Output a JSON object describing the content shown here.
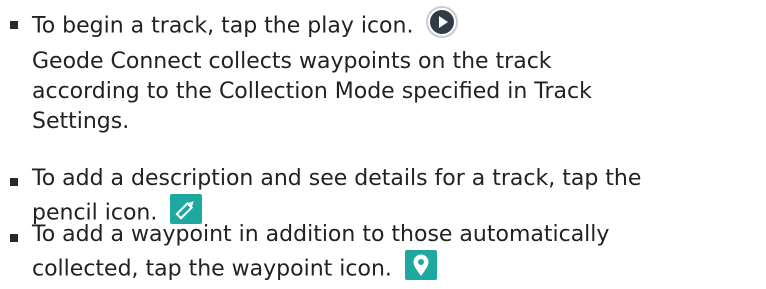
{
  "colors": {
    "text": "#222222",
    "play_icon_bg": "#2f3b47",
    "accent_teal": "#1fa8a0"
  },
  "items": [
    {
      "icon": "play-icon",
      "lines": [
        "To begin a track, tap the play icon.",
        "Geode Connect collects waypoints on the track",
        "according to the Collection Mode specified in Track",
        "Settings."
      ]
    },
    {
      "icon": "pencil-icon",
      "lines": [
        "To add a description and see details for a track, tap the",
        "pencil icon."
      ]
    },
    {
      "icon": "waypoint-icon",
      "lines": [
        "To add a waypoint in addition to those automatically",
        "collected, tap the waypoint icon."
      ]
    }
  ]
}
